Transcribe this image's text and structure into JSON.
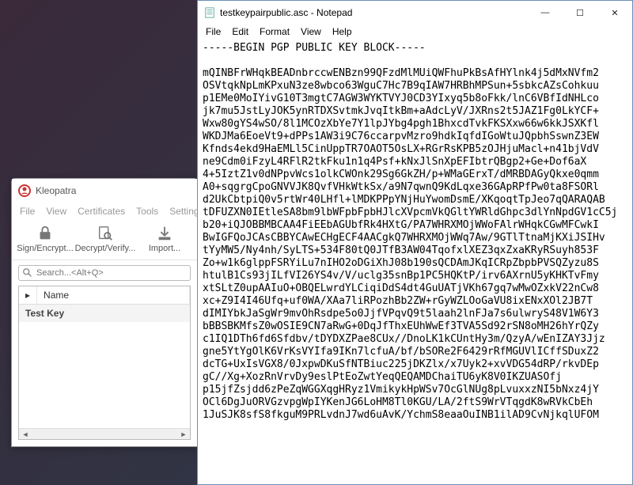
{
  "kleopatra": {
    "title": "Kleopatra",
    "menu": {
      "file": "File",
      "view": "View",
      "certificates": "Certificates",
      "tools": "Tools",
      "settings": "Setting"
    },
    "toolbar": {
      "sign": "Sign/Encrypt...",
      "decrypt": "Decrypt/Verify...",
      "import": "Import..."
    },
    "search_placeholder": "Search...<Alt+Q>",
    "columns": {
      "name": "Name"
    },
    "rows": [
      "Test Key"
    ]
  },
  "notepad": {
    "title": "testkeypairpublic.asc - Notepad",
    "menu": {
      "file": "File",
      "edit": "Edit",
      "format": "Format",
      "view": "View",
      "help": "Help"
    },
    "content": "-----BEGIN PGP PUBLIC KEY BLOCK-----\n\nmQINBFrWHqkBEADnbrccwENBzn99QFzdMlMUiQWFhuPkBsAfHYlnk4j5dMxNVfm2\nOSVtqkNpLmKPxuN3ze8wbco63WguC7Hc7B9qIAW7HRBhMPSun+5sbkcAZsCohkuu\np1EMe0MoIYivG10T3mgtC7AGW3WYKTVYJ0CD3YIxyq5b8oFkk/lnC6VBfIdNHLco\njk7mu5JstLyJOK5ynRTDXSvtmkJvqItkBm+aAdcLyV/JXRns2t5JAZ1Fg0LkYCF+\nWxw80gYS4wSO/8l1MCOzXbYe7Y1lpJYbg4pgh1BhxcdTvkFKSXxw66w6kkJSXKfl\nWKDJMa6EoeVt9+dPPs1AW3i9C76ccarpvMzro9hdkIqfdIGoWtuJQpbhSswnZ3EW\nKfnds4ekd9HaEMLl5CinUppTR7OAOT5OsLX+RGrRsKPB5zOJHjuMacl+n41bjVdV\nne9Cdm0iFzyL4RFlR2tkFku1n1q4Psf+kNxJlSnXpEFIbtrQBgp2+Ge+Dof6aX\n4+5IztZ1v0dNPpvWcs1olkCWOnk29Sg6GkZH/p+WMaGErxT/dMRBDAGyQkxe0qmm\nA0+sqgrgCpoGNVVJK8QvfVHkWtkSx/a9N7qwnQ9KdLqxe36GApRPfPw0ta8FSORl\nd2UkCbtpiQ0v5rtWr40LHfl+lMDKPPpYNjHuYwomDsmE/XKqoqtTpJeo7qQARAQAB\ntDFUZXN0IEtleSA8bm9lbWFpbFpbHJlcXVpcmVkQGltYWRldGhpc3dlYnNpdGV1cC5j\nb20+iQJOBBMBCAA4FiEEbAGUbfRk4HXtG/PA7WHRXMOjWWoFAlrWHqkCGwMFCwkI\nBwIGFQoJCAsCBBYCAwECHgECF4AACgkQ7WHRXMOjWWq7Aw/9GTlTtnaMjKXiJSIHv\ntYyMW5/Ny4nh/SyLTS+534F80tQ0JTfB3AW04TqofxlXEZ3qxZxaKRyRSuyh853F\nZo+w1k6glppFSRYiLu7nIHO2oDGiXhJ08b190sQCDAmJKqICRpZbpbPVSQZyzu8S\nhtulB1Cs93jILfVI26YS4v/V/uclg35snBp1PC5HQKtP/irv6AXrnU5yKHKTvFmy\nxtSLtZ0upAAIuO+OBQELwrdYLCiqiDdS4dt4GuUATjVKh67gq7wMwOZxkV22nCw8\nxc+Z9I4I46Ufq+uf0WA/XAa7liRPozhBb2ZW+rGyWZLOoGaVU8ixENxXOl2JB7T\ndIMIYbkJaSgWr9mvOhRsdpe5o0JjfVPqvQ9t5laah2lnFJa7s6ulwryS48V1W6Y3\nbBBSBKMfsZ0wOSIE9CN7aRwG+0DqJfThxEUhWwEf3TVA5Sd92rSN8oMH26hYrQZy\nc1IQ1DTh6fd6Sfdbv/tDYDXZPae8CUx//DnoLK1kCUntHy3m/QzyA/wEnIZAY3Jjz\ngne5YtYgOlK6VrKsVYIfa9IKn7lcfuA/bf/bSORe2F6429rRfMGUVlICffSDuxZ2\ndcTG+UxIsVGX8/0JxpwDKuSfNTBiuc225jDKZlx/x7Uyk2+xvVDG54dRP/rkvDEp\ngC//Xg+XozRnVrvDy9eslPtEoZwtYeqQEQAMDChaiTU6yK8V0IKZUASOfj\np15jfZsjdd6zPeZqWGGXqgHRyz1VmikykHpWSv7OcGlNUg8pLvuxxzNI5bNxz4jY\nOCl6DgJuORVGzvpgWpIYKenJG6LoHM8Tl0KGU/LA/2ftS9WrVTqgdK8wRVkCbEh\n1JuSJK8sfS8fkguM9PRLvdnJ7wd6uAvK/YchmS8eaaOuINB1ilAD9CvNjkqlUFOM"
  }
}
